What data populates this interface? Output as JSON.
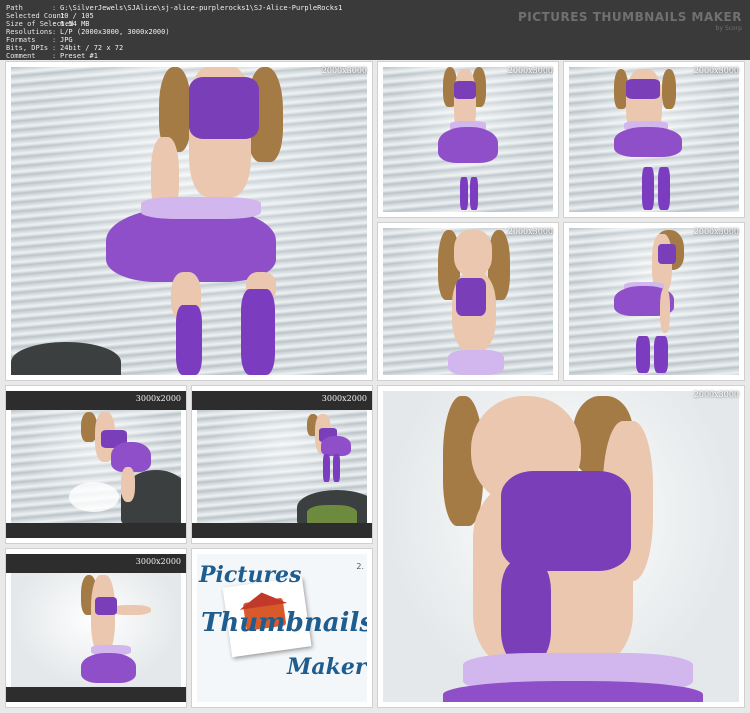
{
  "header": {
    "brand_title": "PICTURES THUMBNAILS MAKER",
    "brand_by": "by Scorp",
    "info": [
      {
        "key": "Path",
        "value": "G:\\SilverJewels\\SJAlice\\sj-alice-purplerocks1\\SJ-Alice-PurpleRocks1"
      },
      {
        "key": "Selected Count",
        "value": "10 / 105"
      },
      {
        "key": "Size of Selected",
        "value": "6.54 MB"
      },
      {
        "key": "Resolutions",
        "value": "L/P (2000x3000, 3000x2000)"
      },
      {
        "key": "Formats",
        "value": "JPG"
      },
      {
        "key": "Bits, DPIs",
        "value": "24bit / 72 x 72"
      },
      {
        "key": "Comment",
        "value": "Preset #1"
      }
    ],
    "separator": ":"
  },
  "thumbnails": [
    {
      "resolution": "2000x3000"
    },
    {
      "resolution": "2000x3000"
    },
    {
      "resolution": "2000x3000"
    },
    {
      "resolution": "2000x3000"
    },
    {
      "resolution": "2000x3000"
    },
    {
      "resolution": "3000x2000"
    },
    {
      "resolution": "3000x2000"
    },
    {
      "resolution": "2000x3000"
    },
    {
      "resolution": "3000x2000"
    }
  ],
  "logo": {
    "line1": "Pictures",
    "line2": "Thumbnails",
    "line3": "Maker",
    "version": "2."
  },
  "colors": {
    "header_bg": "#3a3a3a",
    "page_bg": "#e9e9e9",
    "accent_purple": "#7a3fb8"
  }
}
